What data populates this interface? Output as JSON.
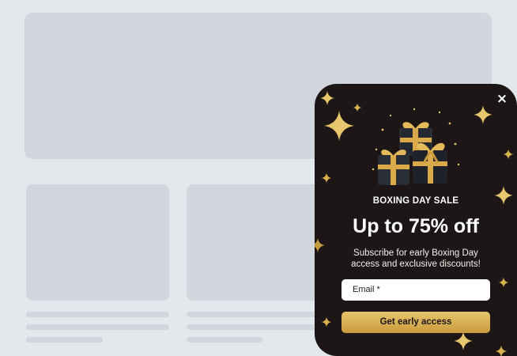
{
  "popup": {
    "close_icon": "×",
    "eyebrow": "BOXING DAY SALE",
    "headline": "Up to 75% off",
    "subtitle": "Subscribe for early Boxing Day access and exclusive discounts!",
    "email_placeholder": "Email *",
    "cta_label": "Get early access",
    "colors": {
      "background": "#1c1617",
      "gold": "#d9b24e",
      "text": "#ffffff"
    },
    "icons": [
      "close-icon",
      "gift-boxes-illustration",
      "sparkle-star-icon"
    ]
  }
}
